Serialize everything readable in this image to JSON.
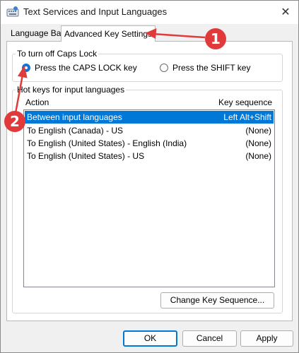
{
  "window": {
    "title": "Text Services and Input Languages",
    "close_glyph": "✕"
  },
  "tabs": [
    {
      "label": "Language Bar",
      "active": false
    },
    {
      "label": "Advanced Key Settings",
      "active": true
    }
  ],
  "caps_lock": {
    "group_label": "To turn off Caps Lock",
    "options": [
      {
        "label": "Press the CAPS LOCK key",
        "checked": true
      },
      {
        "label": "Press the SHIFT key",
        "checked": false
      }
    ]
  },
  "hotkeys": {
    "group_label": "Hot keys for input languages",
    "columns": {
      "action": "Action",
      "key": "Key sequence"
    },
    "rows": [
      {
        "action": "Between input languages",
        "key": "Left Alt+Shift",
        "selected": true
      },
      {
        "action": "To English (Canada) - US",
        "key": "(None)",
        "selected": false
      },
      {
        "action": "To English (United States) - English (India)",
        "key": "(None)",
        "selected": false
      },
      {
        "action": "To English (United States) - US",
        "key": "(None)",
        "selected": false
      }
    ],
    "change_button": "Change Key Sequence..."
  },
  "footer": {
    "ok": "OK",
    "cancel": "Cancel",
    "apply": "Apply"
  },
  "annotations": {
    "step1": "1",
    "step2": "2",
    "color": "#e03a3a"
  },
  "colors": {
    "selection": "#0078d7",
    "radio_checked": "#1f6fd1"
  },
  "icons": [
    "keyboard-app-icon",
    "close-icon"
  ]
}
